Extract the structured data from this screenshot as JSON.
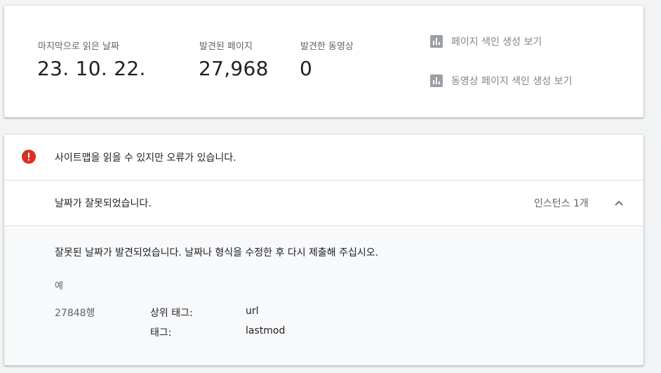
{
  "stats": {
    "last_read_label": "마지막으로 읽은 날짜",
    "last_read_value": "23. 10. 22.",
    "pages_label": "발견된 페이지",
    "pages_value": "27,968",
    "videos_label": "발견한 동영상",
    "videos_value": "0"
  },
  "reports": {
    "page_index": "페이지 색인 생성 보기",
    "video_index": "동영상 페이지 색인 생성 보기"
  },
  "issue": {
    "status_text": "사이트맵을 읽을 수 있지만 오류가 있습니다.",
    "problem_title": "날짜가 잘못되었습니다.",
    "instances": "인스턴스 1개",
    "description": "잘못된 날짜가 발견되었습니다. 날짜나 형식을 수정한 후 다시 제출해 주십시오.",
    "example_label": "예",
    "row_label": "27848행",
    "parent_tag_label": "상위 태그:",
    "parent_tag_value": "url",
    "tag_label": "태그:",
    "tag_value": "lastmod"
  },
  "colors": {
    "error": "#d93025",
    "icon_gray": "#9aa0a6"
  }
}
